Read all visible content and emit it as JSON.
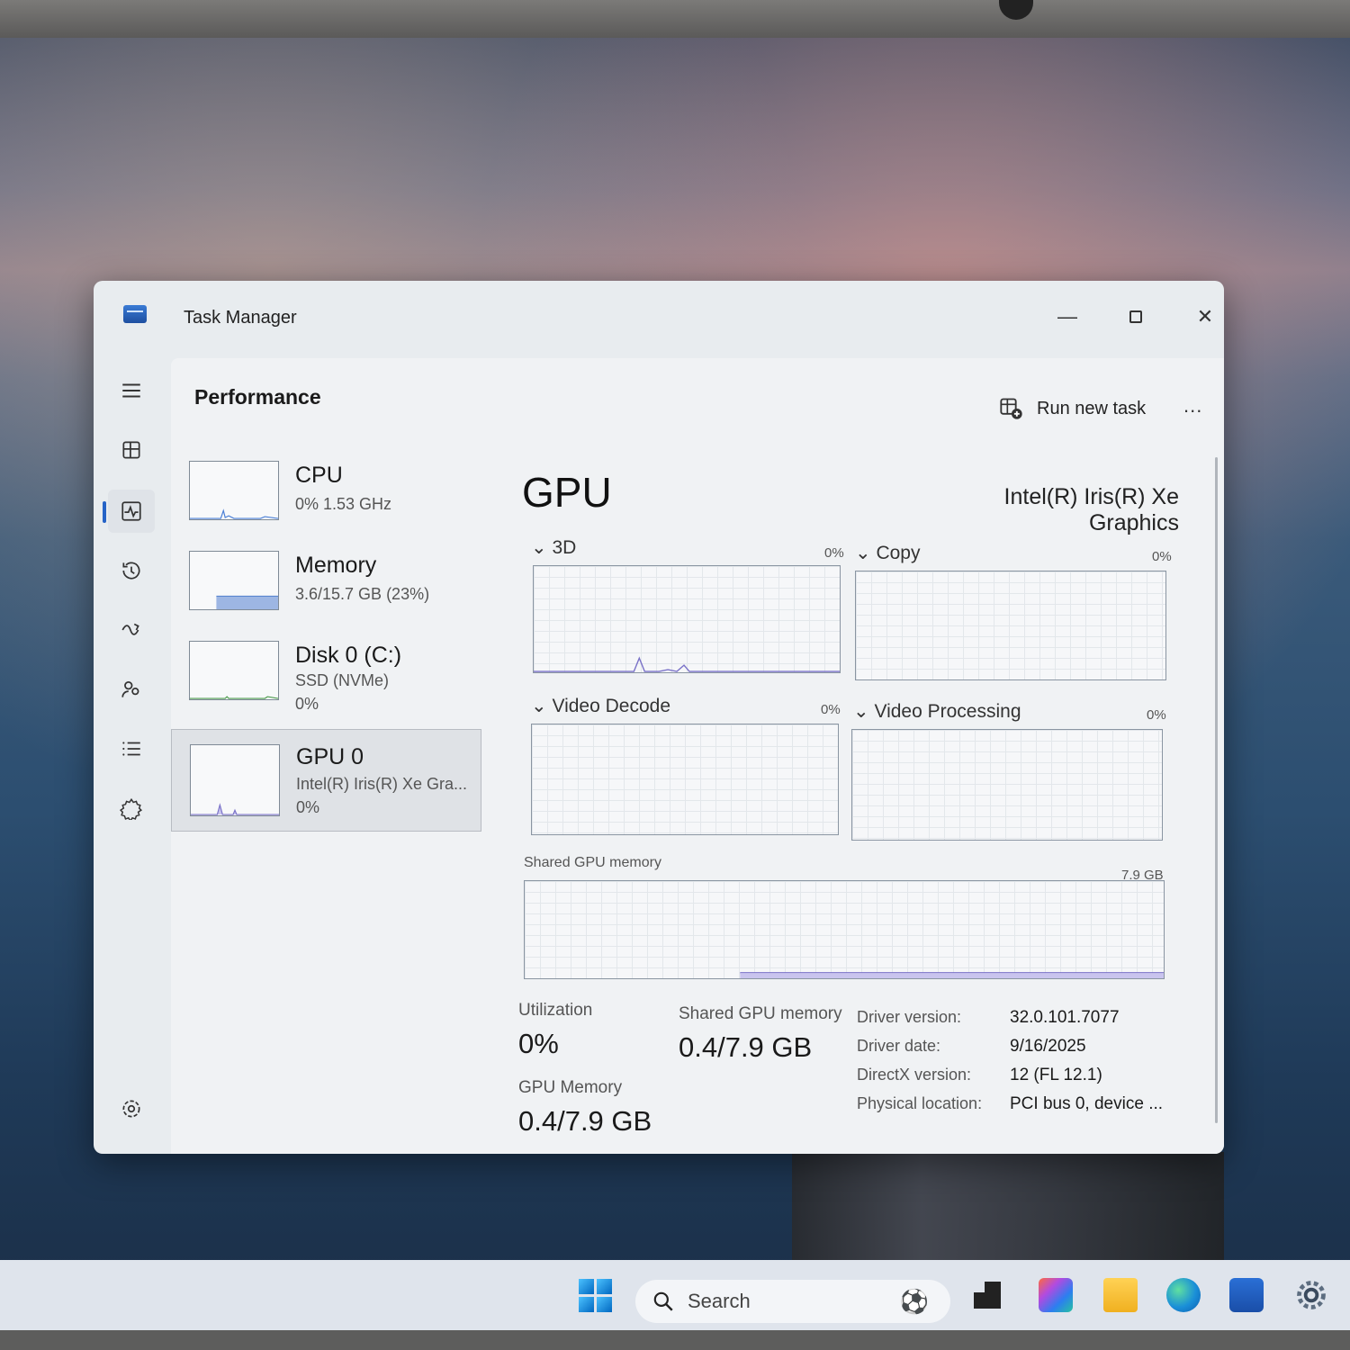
{
  "window": {
    "title": "Task Manager",
    "min_glyph": "—",
    "close_glyph": "✕"
  },
  "rail": {
    "items": [
      {
        "icon": "hamburger-icon"
      },
      {
        "icon": "processes-icon"
      },
      {
        "icon": "performance-icon",
        "active": true
      },
      {
        "icon": "app-history-icon"
      },
      {
        "icon": "startup-apps-icon"
      },
      {
        "icon": "users-icon"
      },
      {
        "icon": "details-icon"
      },
      {
        "icon": "services-icon"
      },
      {
        "icon": "settings-icon"
      }
    ]
  },
  "header": {
    "title": "Performance",
    "run_new_task": "Run new task",
    "more": "..."
  },
  "devices": [
    {
      "name": "CPU",
      "line1": "0%  1.53 GHz"
    },
    {
      "name": "Memory",
      "line1": "3.6/15.7 GB (23%)"
    },
    {
      "name": "Disk 0 (C:)",
      "line1": "SSD (NVMe)",
      "line2": "0%"
    },
    {
      "name": "GPU 0",
      "line1": "Intel(R) Iris(R) Xe Gra...",
      "line2": "0%",
      "selected": true
    }
  ],
  "gpu": {
    "title": "GPU",
    "model": "Intel(R) Iris(R) Xe Graphics",
    "engines": [
      {
        "label": "3D",
        "pct": "0%"
      },
      {
        "label": "Copy",
        "pct": "0%"
      },
      {
        "label": "Video Decode",
        "pct": "0%"
      },
      {
        "label": "Video Processing",
        "pct": "0%"
      }
    ],
    "shared_label": "Shared GPU memory",
    "shared_max": "7.9 GB",
    "stats": {
      "utilization_label": "Utilization",
      "utilization_value": "0%",
      "shared_mem_label": "Shared GPU memory",
      "shared_mem_value": "0.4/7.9 GB",
      "gpu_mem_label": "GPU Memory",
      "gpu_mem_value": "0.4/7.9 GB"
    },
    "info": [
      {
        "k": "Driver version:",
        "v": "32.0.101.7077"
      },
      {
        "k": "Driver date:",
        "v": "9/16/2025"
      },
      {
        "k": "DirectX version:",
        "v": "12 (FL 12.1)"
      },
      {
        "k": "Physical location:",
        "v": "PCI bus 0, device ..."
      }
    ]
  },
  "taskbar": {
    "search_placeholder": "Search"
  },
  "colors": {
    "accent": "#2563c7",
    "graph_line": "#7a72c8",
    "memory_fill": "#9db6e3"
  }
}
